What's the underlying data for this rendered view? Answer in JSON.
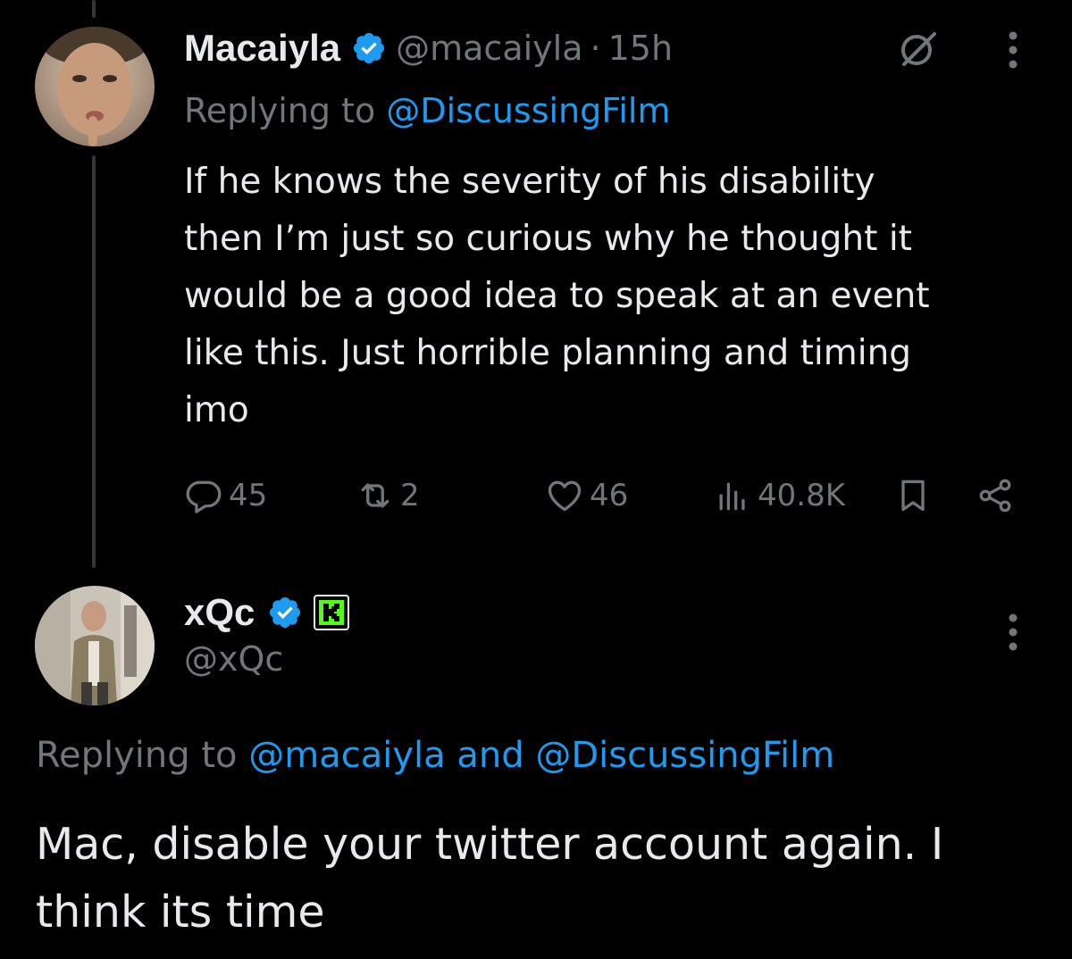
{
  "tweet": {
    "display_name": "Macaiyla",
    "handle": "@macaiyla",
    "separator": "·",
    "time": "15h",
    "replying_prefix": "Replying to ",
    "replying_to": "@DiscussingFilm",
    "text_lines": [
      "If he knows the severity of his disability",
      "then I’m just so curious why he thought it",
      "would be a good idea to speak at an event",
      "like this. Just horrible planning and timing",
      "imo"
    ],
    "stats": {
      "replies": "45",
      "reposts": "2",
      "likes": "46",
      "views": "40.8K"
    },
    "icons": {
      "grok": "grok-icon",
      "more": "more-options-icon",
      "reply": "reply-icon",
      "repost": "repost-icon",
      "like": "heart-icon",
      "views": "views-icon",
      "bookmark": "bookmark-icon",
      "share": "share-icon"
    }
  },
  "reply": {
    "display_name": "xQc",
    "handle": "@xQc",
    "replying_prefix": "Replying to ",
    "mention_1": "@macaiyla",
    "and_word": " and ",
    "mention_2": "@DiscussingFilm",
    "text_lines": [
      "Mac, disable your twitter account again. I",
      "think its time"
    ],
    "kick_letter": "K"
  },
  "colors": {
    "background": "#000000",
    "text": "#e7e9ea",
    "muted": "#71767b",
    "accent": "#1d9bf0",
    "kick_green": "#53fc18"
  }
}
